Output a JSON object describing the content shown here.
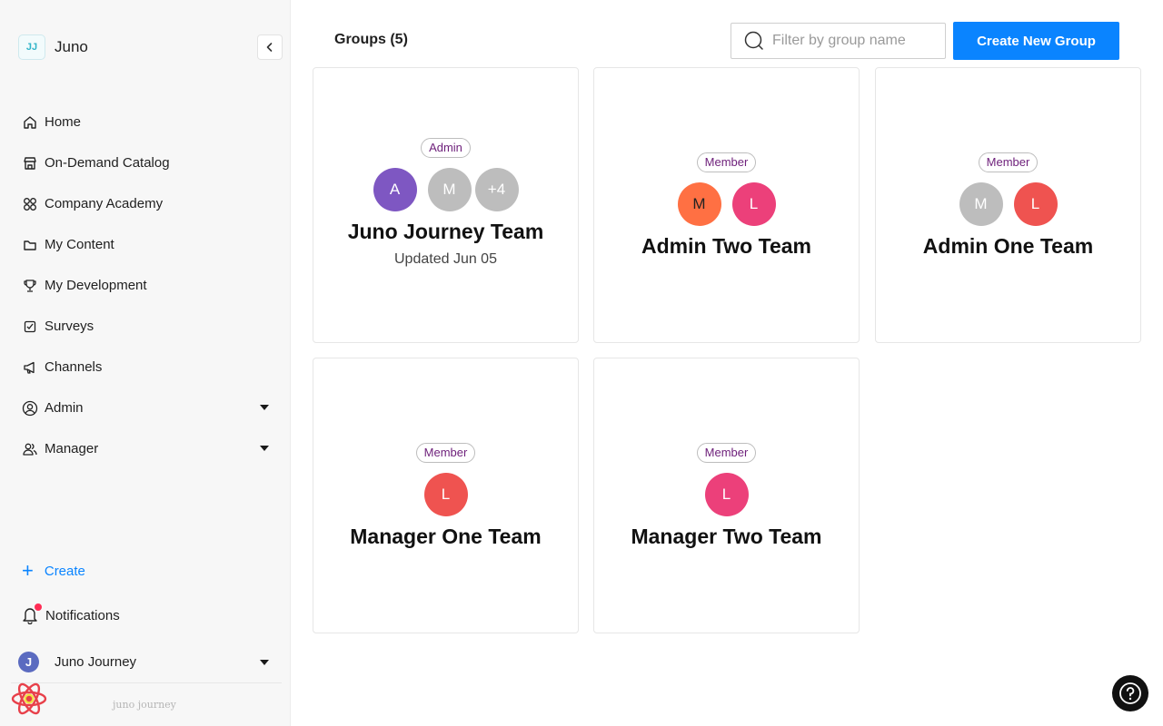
{
  "app": {
    "name": "Juno",
    "logo_text": "JJ",
    "footer_logo": "juno journey"
  },
  "nav": [
    {
      "label": "Home",
      "icon": "home-icon"
    },
    {
      "label": "On-Demand Catalog",
      "icon": "store-icon"
    },
    {
      "label": "Company Academy",
      "icon": "grid-icon"
    },
    {
      "label": "My Content",
      "icon": "folder-icon"
    },
    {
      "label": "My Development",
      "icon": "trophy-icon"
    },
    {
      "label": "Surveys",
      "icon": "survey-icon"
    },
    {
      "label": "Channels",
      "icon": "megaphone-icon"
    },
    {
      "label": "Admin",
      "icon": "user-circle-icon",
      "expandable": true
    },
    {
      "label": "Manager",
      "icon": "users-icon",
      "expandable": true
    }
  ],
  "sidebar_bottom": {
    "create_label": "Create",
    "notifications_label": "Notifications",
    "user_name": "Juno Journey",
    "user_initial": "J"
  },
  "header": {
    "title": "Groups (5)",
    "filter_placeholder": "Filter by group name",
    "filter_value": "",
    "create_button": "Create New Group"
  },
  "groups": [
    {
      "title": "Juno Journey Team",
      "role": "Admin",
      "subtitle": "Updated Jun 05",
      "avatars": [
        {
          "text": "A",
          "color": "#7e57c2"
        },
        {
          "text": "M",
          "color": "#bdbdbd"
        },
        {
          "text": "+4",
          "color": "#bdbdbd"
        }
      ]
    },
    {
      "title": "Admin Two Team",
      "role": "Member",
      "subtitle": "",
      "avatars": [
        {
          "text": "M",
          "color": "#ff7043"
        },
        {
          "text": "L",
          "color": "#ec407a"
        }
      ]
    },
    {
      "title": "Admin One Team",
      "role": "Member",
      "subtitle": "",
      "avatars": [
        {
          "text": "M",
          "color": "#bdbdbd"
        },
        {
          "text": "L",
          "color": "#ef5350"
        }
      ]
    },
    {
      "title": "Manager One Team",
      "role": "Member",
      "subtitle": "",
      "avatars": [
        {
          "text": "L",
          "color": "#ef5350"
        }
      ]
    },
    {
      "title": "Manager Two Team",
      "role": "Member",
      "subtitle": "",
      "avatars": [
        {
          "text": "L",
          "color": "#ec407a"
        }
      ]
    }
  ],
  "colors": {
    "accent": "#0a84ff",
    "badge_text": "#6d1f7a",
    "notification_dot": "#ff2d55"
  },
  "help_icon": "help-circle-icon"
}
